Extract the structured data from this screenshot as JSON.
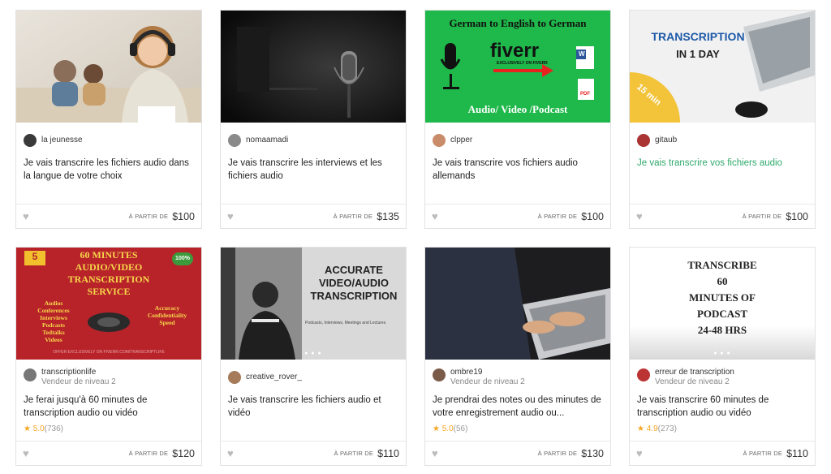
{
  "price_prefix": "À PARTIR DE",
  "cards": [
    {
      "seller": "la jeunesse",
      "level": "",
      "title": "Je vais transcrire les fichiers audio dans la langue de votre choix",
      "price": "$100",
      "rating": "",
      "reviews": ""
    },
    {
      "seller": "nomaamadi",
      "level": "",
      "title": "Je vais transcrire les interviews et les fichiers audio",
      "price": "$135",
      "rating": "",
      "reviews": ""
    },
    {
      "seller": "clpper",
      "level": "",
      "title": "Je vais transcrire vos fichiers audio allemands",
      "price": "$100",
      "rating": "",
      "reviews": "",
      "overlay": {
        "top": "German to English to German",
        "brand": "fiverr",
        "brand_sub": "EXCLUSIVELY ON FIVERR",
        "bottom": "Audio/ Video /Podcast",
        "pdf": "PDF",
        "word": "W"
      }
    },
    {
      "seller": "gitaub",
      "level": "",
      "title": "Je vais transcrire vos fichiers audio",
      "price": "$100",
      "rating": "",
      "reviews": "",
      "overlay": {
        "line1": "TRANSCRIPTION",
        "line2": "IN 1 DAY",
        "badge": "15 min"
      }
    },
    {
      "seller": "transcriptionlife",
      "level": "Vendeur de niveau 2",
      "title": "Je ferai jusqu'à 60 minutes de transcription audio ou vidéo",
      "price": "$120",
      "rating": "5.0",
      "reviews": "(736)",
      "overlay": {
        "line1": "60 MINUTES",
        "line2": "AUDIO/VIDEO",
        "line3": "TRANSCRIPTION",
        "line4": "SERVICE",
        "left": "Audios\nConferences\nInterviews\nPodcasts\nTedtalks\nVideos",
        "right": "Accuracy\nConfidentiality\nSpeed",
        "badge_left": "5",
        "badge_right": "100%",
        "footer": "OFFER EXCLUSIVELY ON FIVERR.COM/TRANSCRIPTLIFE"
      }
    },
    {
      "seller": "creative_rover_",
      "level": "",
      "title": "Je vais transcrire les fichiers audio et vidéo",
      "price": "$110",
      "rating": "",
      "reviews": "",
      "overlay": {
        "line1": "ACCURATE",
        "line2": "VIDEO/AUDIO",
        "line3": "TRANSCRIPTION",
        "sub": "Podcasts, Interviews, Meetings and Lectures"
      }
    },
    {
      "seller": "ombre19",
      "level": "Vendeur de niveau 2",
      "title": "Je prendrai des notes ou des minutes de votre enregistrement audio ou...",
      "price": "$130",
      "rating": "5.0",
      "reviews": "(56)"
    },
    {
      "seller": "erreur de transcription",
      "level": "Vendeur de niveau 2",
      "title": "Je vais transcrire 60 minutes de transcription audio ou vidéo",
      "price": "$110",
      "rating": "4.9",
      "reviews": "(273)",
      "overlay": {
        "line1": "TRANSCRIBE",
        "line2": "60",
        "line3": "MINUTES OF",
        "line4": "PODCAST",
        "line5": "24-48 HRS"
      }
    }
  ],
  "colors": {
    "accent_green": "#2ea86b",
    "star": "#f5a623",
    "thumb3_bg": "#1fb84a",
    "thumb5_bg": "#b8232a"
  }
}
